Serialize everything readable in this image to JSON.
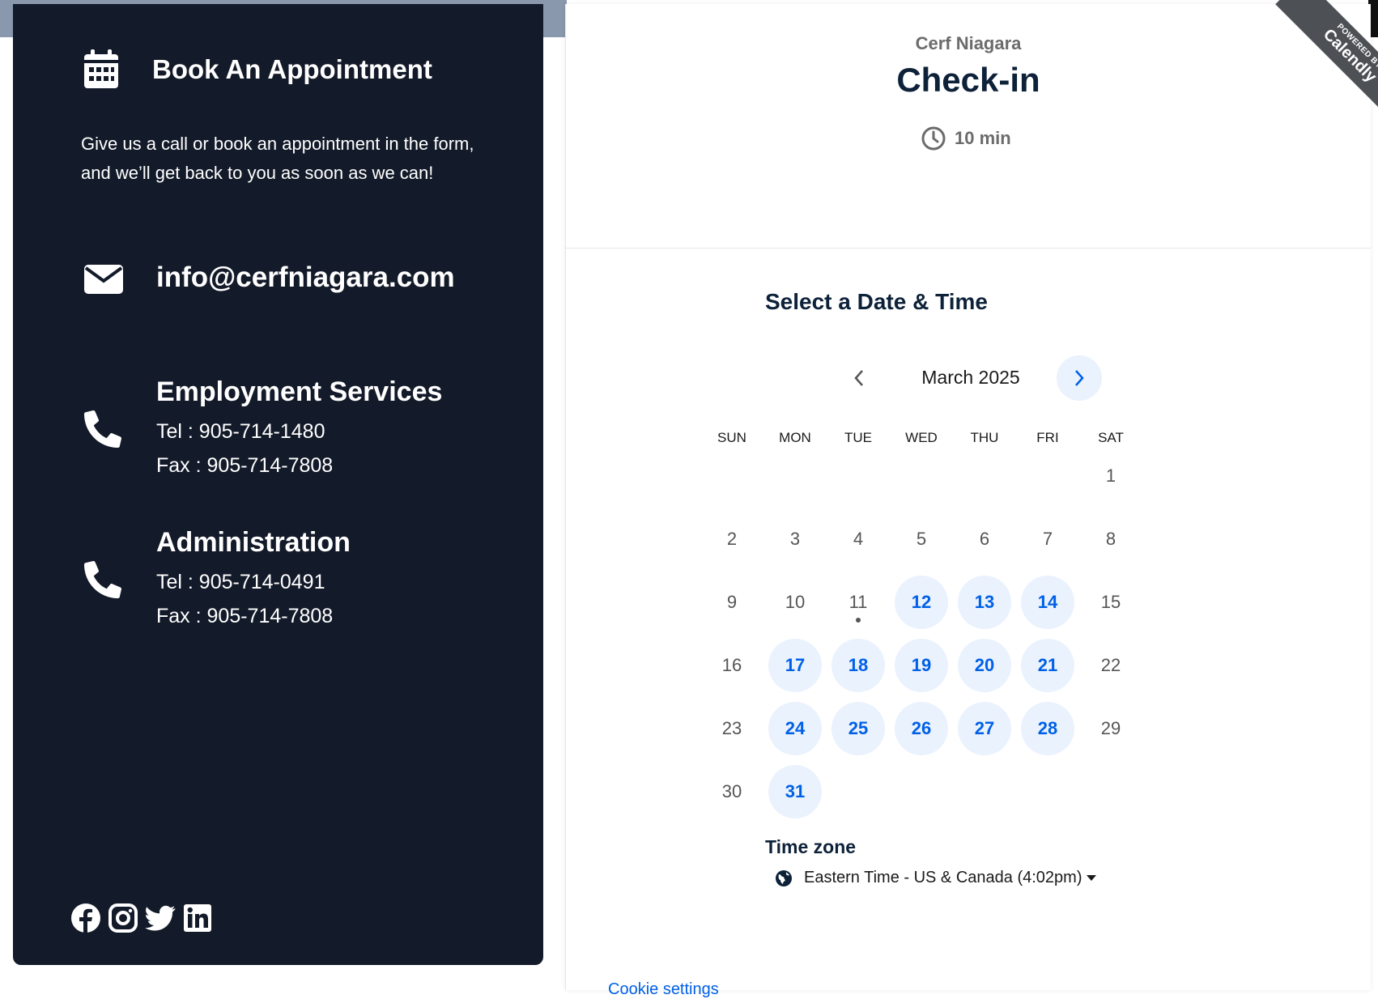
{
  "panel": {
    "book_title": "Book An Appointment",
    "book_desc": "Give us a call or book an appointment in the form, and we’ll get back to you as soon as we can!",
    "email": "info@cerfniagara.com",
    "sections": [
      {
        "title": "Employment Services",
        "tel": "Tel : 905-714-1480",
        "fax": "Fax : 905-714-7808"
      },
      {
        "title": "Administration",
        "tel": "Tel : 905-714-0491",
        "fax": "Fax : 905-714-7808"
      }
    ],
    "social_icons": [
      "facebook-icon",
      "instagram-icon",
      "twitter-icon",
      "linkedin-icon"
    ]
  },
  "scheduler": {
    "organization": "Cerf Niagara",
    "event_name": "Check-in",
    "duration": "10 min",
    "ribbon_small": "POWERED BY",
    "ribbon_big": "Calendly",
    "select_title": "Select a Date & Time",
    "month": "March 2025",
    "weekdays": [
      "SUN",
      "MON",
      "TUE",
      "WED",
      "THU",
      "FRI",
      "SAT"
    ],
    "weeks": [
      [
        null,
        null,
        null,
        null,
        null,
        null,
        1
      ],
      [
        2,
        3,
        4,
        5,
        6,
        7,
        8
      ],
      [
        9,
        10,
        11,
        12,
        13,
        14,
        15
      ],
      [
        16,
        17,
        18,
        19,
        20,
        21,
        22
      ],
      [
        23,
        24,
        25,
        26,
        27,
        28,
        29
      ],
      [
        30,
        31,
        null,
        null,
        null,
        null,
        null
      ]
    ],
    "available_days": [
      12,
      13,
      14,
      17,
      18,
      19,
      20,
      21,
      24,
      25,
      26,
      27,
      28,
      31
    ],
    "today": 11,
    "timezone_label": "Time zone",
    "timezone_value": "Eastern Time - US & Canada (4:02pm)",
    "cookie_link": "Cookie settings"
  },
  "colors": {
    "panel_bg": "#131a29",
    "accent_blue": "#0060e6",
    "available_bg": "#eaf2fe",
    "heading": "#0d2139"
  }
}
